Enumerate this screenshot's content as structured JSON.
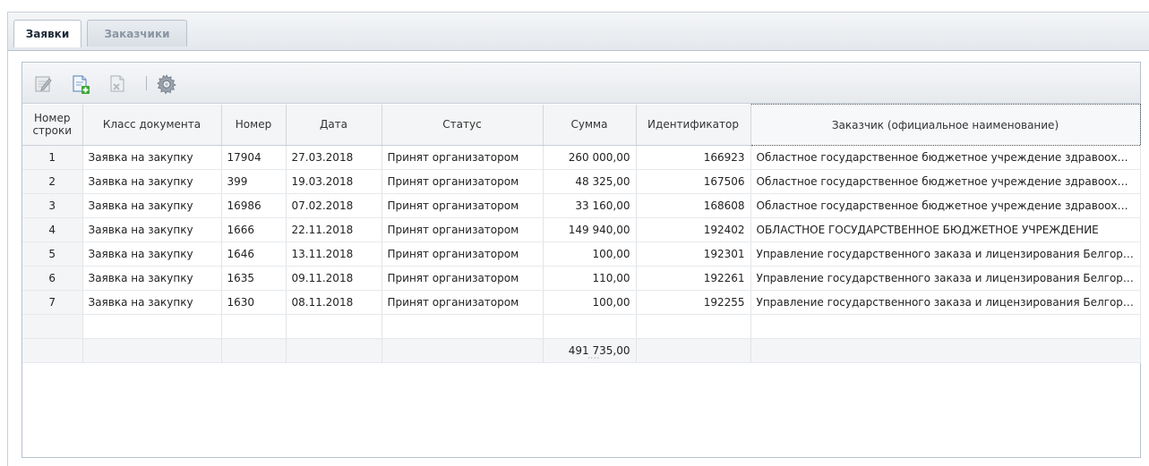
{
  "tabs": [
    {
      "label": "Заявки",
      "active": true
    },
    {
      "label": "Заказчики",
      "active": false
    }
  ],
  "toolbar": {
    "icons": [
      "edit-icon",
      "add-document-icon",
      "delete-document-icon",
      "settings-gear-icon"
    ]
  },
  "grid": {
    "headers": {
      "row_num": "Номер строки",
      "doc_class": "Класс документа",
      "number": "Номер",
      "date": "Дата",
      "status": "Статус",
      "sum": "Сумма",
      "identifier": "Идентификатор",
      "customer": "Заказчик (официальное наименование)"
    },
    "rows": [
      {
        "n": "1",
        "doc_class": "Заявка на закупку",
        "number": "17904",
        "date": "27.03.2018",
        "status": "Принят организатором",
        "sum": "260 000,00",
        "identifier": "166923",
        "customer": "Областное государственное бюджетное учреждение здравоохранения"
      },
      {
        "n": "2",
        "doc_class": "Заявка на закупку",
        "number": "399",
        "date": "19.03.2018",
        "status": "Принят организатором",
        "sum": "48 325,00",
        "identifier": "167506",
        "customer": "Областное государственное бюджетное учреждение здравоохранения"
      },
      {
        "n": "3",
        "doc_class": "Заявка на закупку",
        "number": "16986",
        "date": "07.02.2018",
        "status": "Принят организатором",
        "sum": "33 160,00",
        "identifier": "168608",
        "customer": "Областное государственное бюджетное учреждение здравоохранения"
      },
      {
        "n": "4",
        "doc_class": "Заявка на закупку",
        "number": "1666",
        "date": "22.11.2018",
        "status": "Принят организатором",
        "sum": "149 940,00",
        "identifier": "192402",
        "customer": "ОБЛАСТНОЕ ГОСУДАРСТВЕННОЕ БЮДЖЕТНОЕ УЧРЕЖДЕНИЕ"
      },
      {
        "n": "5",
        "doc_class": "Заявка на закупку",
        "number": "1646",
        "date": "13.11.2018",
        "status": "Принят организатором",
        "sum": "100,00",
        "identifier": "192301",
        "customer": "Управление государственного заказа и лицензирования Белгородской области"
      },
      {
        "n": "6",
        "doc_class": "Заявка на закупку",
        "number": "1635",
        "date": "09.11.2018",
        "status": "Принят организатором",
        "sum": "110,00",
        "identifier": "192261",
        "customer": "Управление государственного заказа и лицензирования Белгородской области"
      },
      {
        "n": "7",
        "doc_class": "Заявка на закупку",
        "number": "1630",
        "date": "08.11.2018",
        "status": "Принят организатором",
        "sum": "100,00",
        "identifier": "192255",
        "customer": "Управление государственного заказа и лицензирования Белгородской области"
      }
    ],
    "total_sum": "491 735,00"
  }
}
